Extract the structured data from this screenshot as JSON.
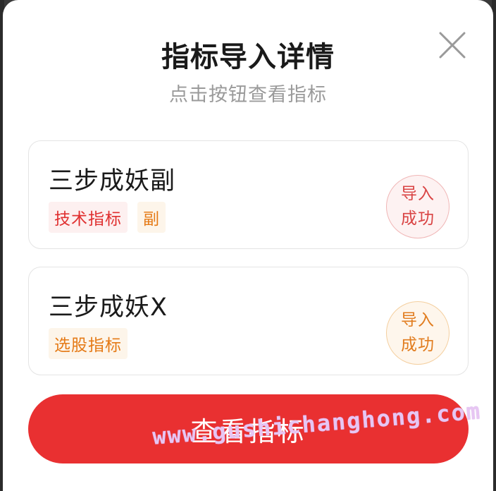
{
  "dialog": {
    "title": "指标导入详情",
    "subtitle": "点击按钮查看指标",
    "close_icon": "close-icon"
  },
  "indicators": [
    {
      "name": "三步成妖副",
      "tags": [
        {
          "label": "技术指标",
          "color": "#e03030"
        },
        {
          "label": "副",
          "color": "#e57a16"
        }
      ],
      "status": {
        "line1": "导入",
        "line2": "成功",
        "color": "#d94343"
      }
    },
    {
      "name": "三步成妖X",
      "tags": [
        {
          "label": "选股指标",
          "color": "#e57a16"
        }
      ],
      "status": {
        "line1": "导入",
        "line2": "成功",
        "color": "#e17c1e"
      }
    }
  ],
  "action": {
    "view_label": "查看指标",
    "color": "#e93031"
  },
  "watermark": "www.gushichanghong.com"
}
